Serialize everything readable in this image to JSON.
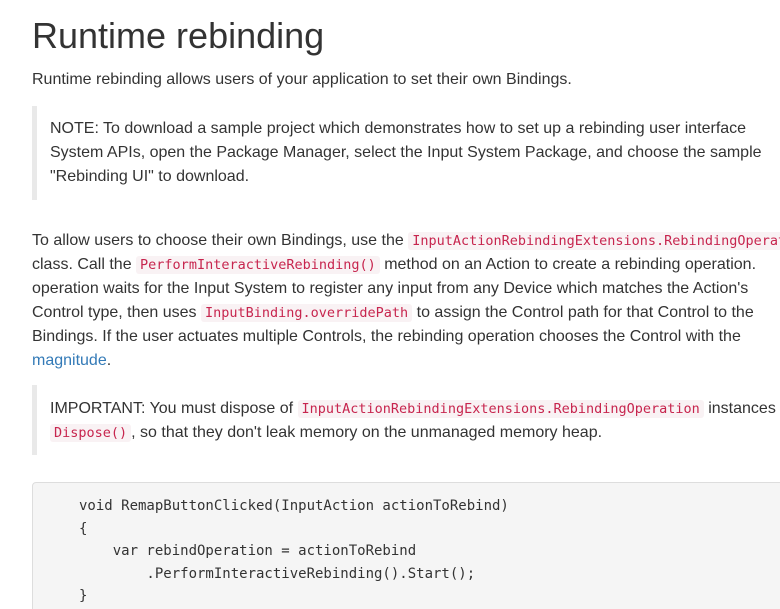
{
  "page": {
    "title": "Runtime rebinding",
    "intro": "Runtime rebinding allows users of your application to set their own Bindings."
  },
  "note": {
    "line1": "NOTE: To download a sample project which demonstrates how to set up a rebinding user interface",
    "line2": "System APIs, open the Package Manager, select the Input System Package, and choose the sample",
    "line3": "\"Rebinding UI\" to download."
  },
  "body": {
    "l1_text": "To allow users to choose their own Bindings, use the ",
    "l1_code": "InputActionRebindingExtensions.RebindingOperation",
    "l2_text_a": "class. Call the ",
    "l2_code": "PerformInteractiveRebinding()",
    "l2_text_b": " method on an Action to create a rebinding operation.",
    "l3_text": "operation waits for the Input System to register any input from any Device which matches the Action's",
    "l4_text_a": "Control type, then uses ",
    "l4_code": "InputBinding.overridePath",
    "l4_text_b": " to assign the Control path for that Control to the",
    "l5_text": "Bindings. If the user actuates multiple Controls, the rebinding operation chooses the Control with the",
    "l6_link": "magnitude",
    "l6_text": "."
  },
  "important": {
    "l1_text_a": "IMPORTANT: You must dispose of ",
    "l1_code": "InputActionRebindingExtensions.RebindingOperation",
    "l1_text_b": " instances",
    "l2_code": "Dispose()",
    "l2_text": ", so that they don't leak memory on the unmanaged memory heap."
  },
  "code": {
    "lines": [
      "void RemapButtonClicked(InputAction actionToRebind)",
      "{",
      "    var rebindOperation = actionToRebind",
      "        .PerformInteractiveRebinding().Start();",
      "}"
    ]
  }
}
